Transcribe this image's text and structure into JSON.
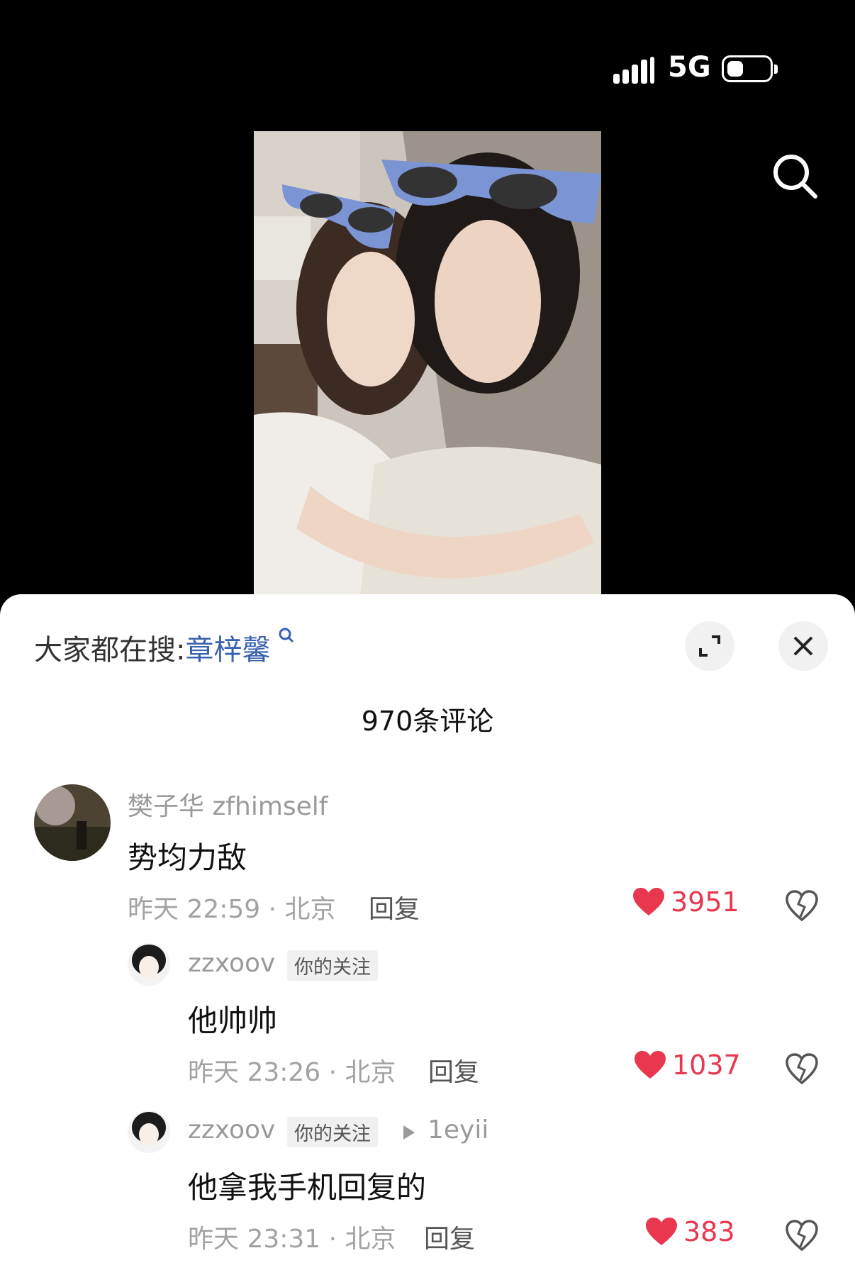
{
  "status": {
    "network": "5G"
  },
  "hot_search": {
    "prefix": "大家都在搜:",
    "keyword": "章梓馨",
    "icon": "search-small-icon"
  },
  "comments_count": "970条评论",
  "comments": [
    {
      "user": "樊子华 zfhimself",
      "text": "势均力敌",
      "meta": "昨天 22:59 · 北京",
      "reply": "回复",
      "likes": "3951"
    },
    {
      "user": "zzxoov",
      "tag": "你的关注",
      "text": "他帅帅",
      "meta": "昨天 23:26 · 北京",
      "reply": "回复",
      "likes": "1037"
    },
    {
      "user": "zzxoov",
      "tag": "你的关注",
      "reply_to": "1eyii",
      "text": "他拿我手机回复的",
      "meta": "昨天 23:31 · 北京",
      "reply": "回复",
      "likes": "383"
    }
  ],
  "colors": {
    "like": "#e8374f",
    "keyword": "#3760b0"
  }
}
